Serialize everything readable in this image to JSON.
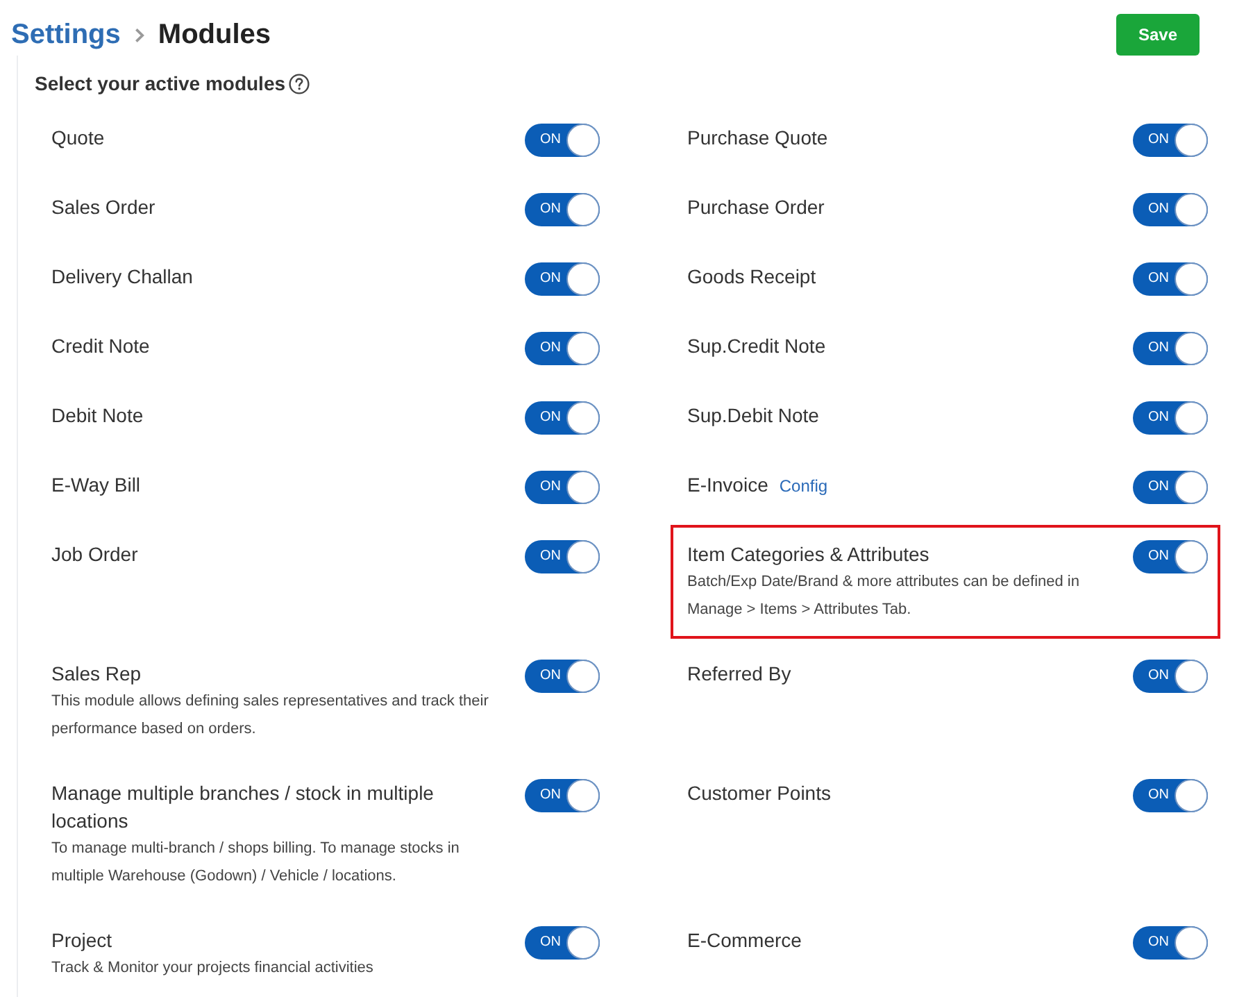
{
  "breadcrumb": {
    "parent": "Settings",
    "current": "Modules"
  },
  "save_button": "Save",
  "section_title": "Select your active modules",
  "modules": [
    {
      "name": "Quote",
      "on": true,
      "switch_text": "ON",
      "highlighted": false
    },
    {
      "name": "Purchase Quote",
      "on": true,
      "switch_text": "ON",
      "highlighted": false
    },
    {
      "name": "Sales Order",
      "on": true,
      "switch_text": "ON",
      "highlighted": false
    },
    {
      "name": "Purchase Order",
      "on": true,
      "switch_text": "ON",
      "highlighted": false
    },
    {
      "name": "Delivery Challan",
      "on": true,
      "switch_text": "ON",
      "highlighted": false
    },
    {
      "name": "Goods Receipt",
      "on": true,
      "switch_text": "ON",
      "highlighted": false
    },
    {
      "name": "Credit Note",
      "on": true,
      "switch_text": "ON",
      "highlighted": false
    },
    {
      "name": "Sup.Credit Note",
      "on": true,
      "switch_text": "ON",
      "highlighted": false
    },
    {
      "name": "Debit Note",
      "on": true,
      "switch_text": "ON",
      "highlighted": false
    },
    {
      "name": "Sup.Debit Note",
      "on": true,
      "switch_text": "ON",
      "highlighted": false
    },
    {
      "name": "E-Way Bill",
      "on": true,
      "switch_text": "ON",
      "highlighted": false
    },
    {
      "name": "E-Invoice",
      "link": "Config",
      "on": true,
      "switch_text": "ON",
      "highlighted": false
    },
    {
      "name": "Job Order",
      "on": true,
      "switch_text": "ON",
      "highlighted": false
    },
    {
      "name": "Item Categories & Attributes",
      "description": "Batch/Exp Date/Brand & more attributes can be defined in Manage > Items > Attributes Tab.",
      "on": true,
      "switch_text": "ON",
      "highlighted": true
    },
    {
      "name": "Sales Rep",
      "description": "This module allows defining sales representatives and track their performance based on orders.",
      "on": true,
      "switch_text": "ON",
      "highlighted": false
    },
    {
      "name": "Referred By",
      "on": true,
      "switch_text": "ON",
      "highlighted": false
    },
    {
      "name": "Manage multiple branches / stock in multiple locations",
      "description": "To manage multi-branch / shops billing. To manage stocks in multiple Warehouse (Godown) / Vehicle / locations.",
      "on": true,
      "switch_text": "ON",
      "highlighted": false
    },
    {
      "name": "Customer Points",
      "on": true,
      "switch_text": "ON",
      "highlighted": false
    },
    {
      "name": "Project",
      "description": "Track & Monitor your projects financial activities",
      "on": true,
      "switch_text": "ON",
      "highlighted": false
    },
    {
      "name": "E-Commerce",
      "on": true,
      "switch_text": "ON",
      "highlighted": false
    }
  ]
}
